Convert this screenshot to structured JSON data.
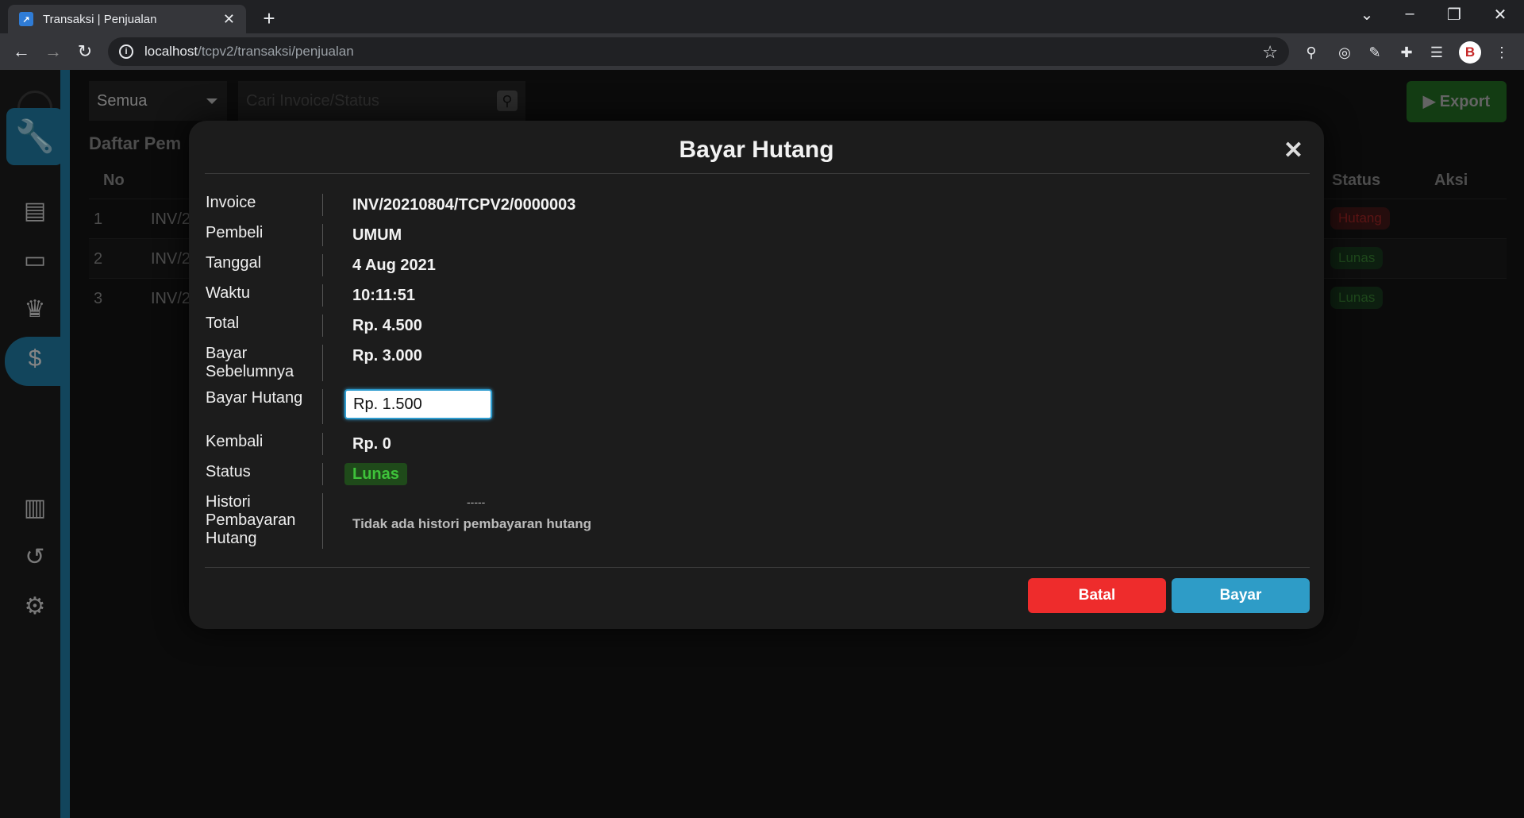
{
  "browser": {
    "tab_title": "Transaksi | Penjualan",
    "tab_close": "✕",
    "new_tab": "+",
    "url_host": "localhost",
    "url_path": "/tcpv2/transaksi/penjualan"
  },
  "app": {
    "filter_value": "Semua",
    "search_placeholder": "Cari Invoice/Status",
    "export_label": "Export",
    "list_title": "Daftar Pem",
    "columns": {
      "no": "No",
      "status": "Status",
      "aksi": "Aksi"
    },
    "rows": [
      {
        "no": "1",
        "invoice": "INV/2",
        "status": "Hutang"
      },
      {
        "no": "2",
        "invoice": "INV/2",
        "status": "Lunas"
      },
      {
        "no": "3",
        "invoice": "INV/2",
        "status": "Lunas"
      }
    ]
  },
  "modal": {
    "title": "Bayar Hutang",
    "close": "✕",
    "fields": {
      "invoice_label": "Invoice",
      "invoice_value": "INV/20210804/TCPV2/0000003",
      "pembeli_label": "Pembeli",
      "pembeli_value": "UMUM",
      "tanggal_label": "Tanggal",
      "tanggal_value": "4 Aug 2021",
      "waktu_label": "Waktu",
      "waktu_value": "10:11:51",
      "total_label": "Total",
      "total_value": "Rp. 4.500",
      "bayar_sebelumnya_label_1": "Bayar",
      "bayar_sebelumnya_label_2": "Sebelumnya",
      "bayar_sebelumnya_value": "Rp. 3.000",
      "bayar_hutang_label": "Bayar Hutang",
      "bayar_hutang_value": "Rp. 1.500",
      "kembali_label": "Kembali",
      "kembali_value": "Rp. 0",
      "status_label": "Status",
      "status_value": "Lunas",
      "histori_label_1": "Histori",
      "histori_label_2": "Pembayaran",
      "histori_label_3": "Hutang",
      "histori_dash": "-----",
      "histori_empty": "Tidak ada histori pembayaran hutang"
    },
    "cancel_label": "Batal",
    "pay_label": "Bayar"
  },
  "colors": {
    "accent": "#2e9cc7",
    "danger": "#ee2c2c",
    "success": "#3ec23a",
    "sidebar_accent": "#1d6b8e"
  }
}
